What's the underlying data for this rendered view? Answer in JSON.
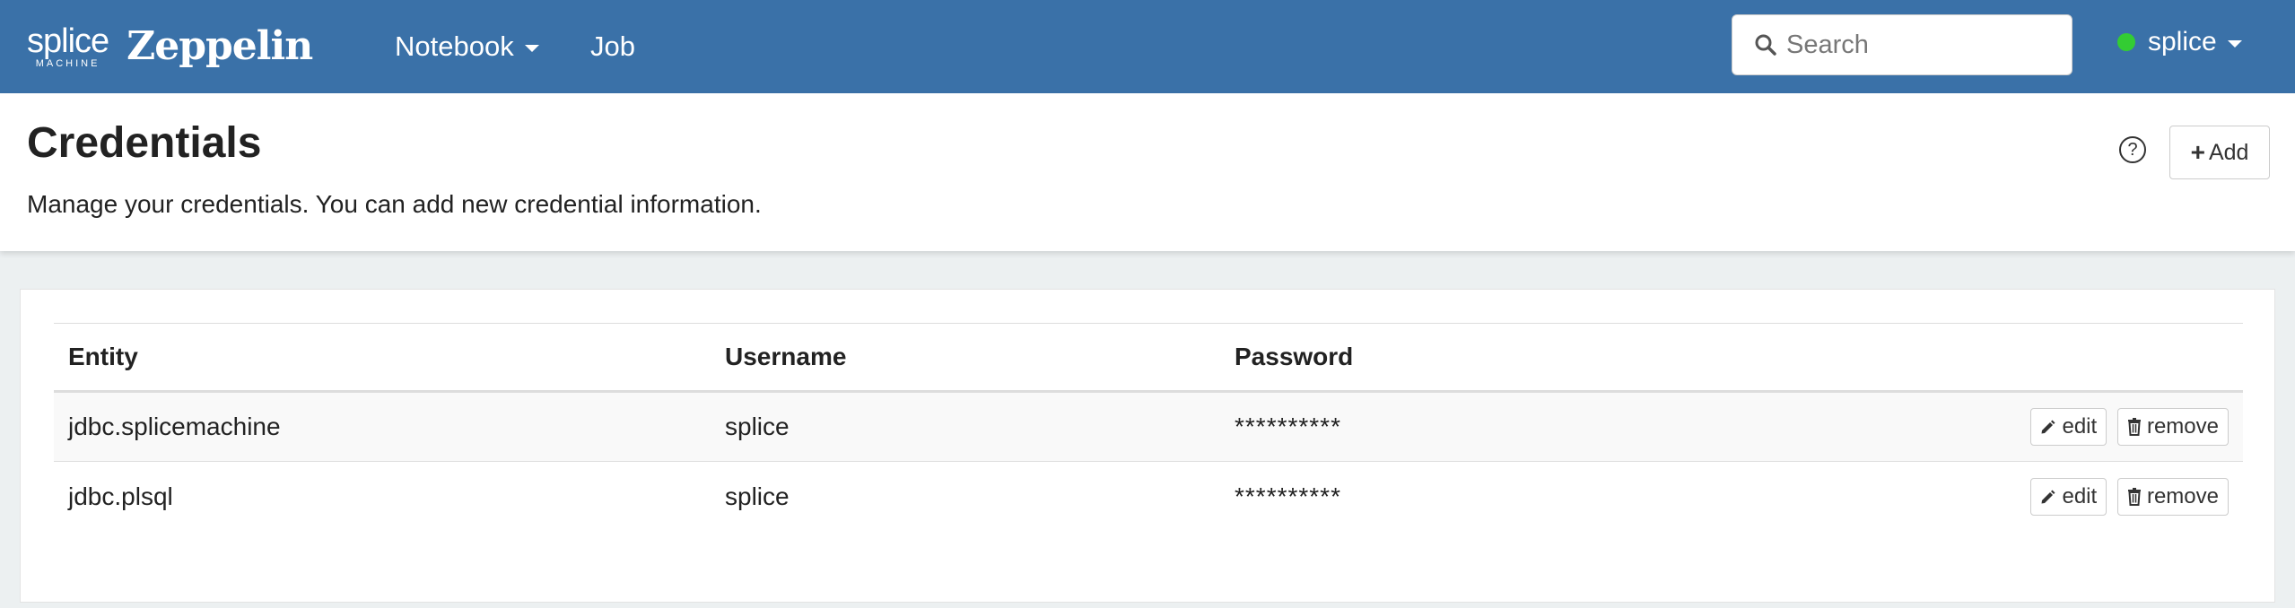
{
  "navbar": {
    "logo_main": "splice",
    "logo_sub": "MACHINE",
    "brand": "Zeppelin",
    "items": [
      {
        "label": "Notebook",
        "has_caret": true
      },
      {
        "label": "Job",
        "has_caret": false
      }
    ],
    "search_placeholder": "Search",
    "user": "splice",
    "user_status_color": "#33cc33",
    "bg_color": "#3a71a8"
  },
  "header": {
    "title": "Credentials",
    "description": "Manage your credentials. You can add new credential information.",
    "help_glyph": "?",
    "add_label": "Add"
  },
  "table": {
    "columns": [
      "Entity",
      "Username",
      "Password",
      ""
    ],
    "rows": [
      {
        "entity": "jdbc.splicemachine",
        "username": "splice",
        "password": "**********",
        "edit_label": "edit",
        "remove_label": "remove"
      },
      {
        "entity": "jdbc.plsql",
        "username": "splice",
        "password": "**********",
        "edit_label": "edit",
        "remove_label": "remove"
      }
    ]
  },
  "icons": {
    "search": "search-icon",
    "caret": "chevron-down-icon",
    "help": "question-circle-icon",
    "add": "plus-icon",
    "edit": "pencil-icon",
    "remove": "trash-icon"
  }
}
